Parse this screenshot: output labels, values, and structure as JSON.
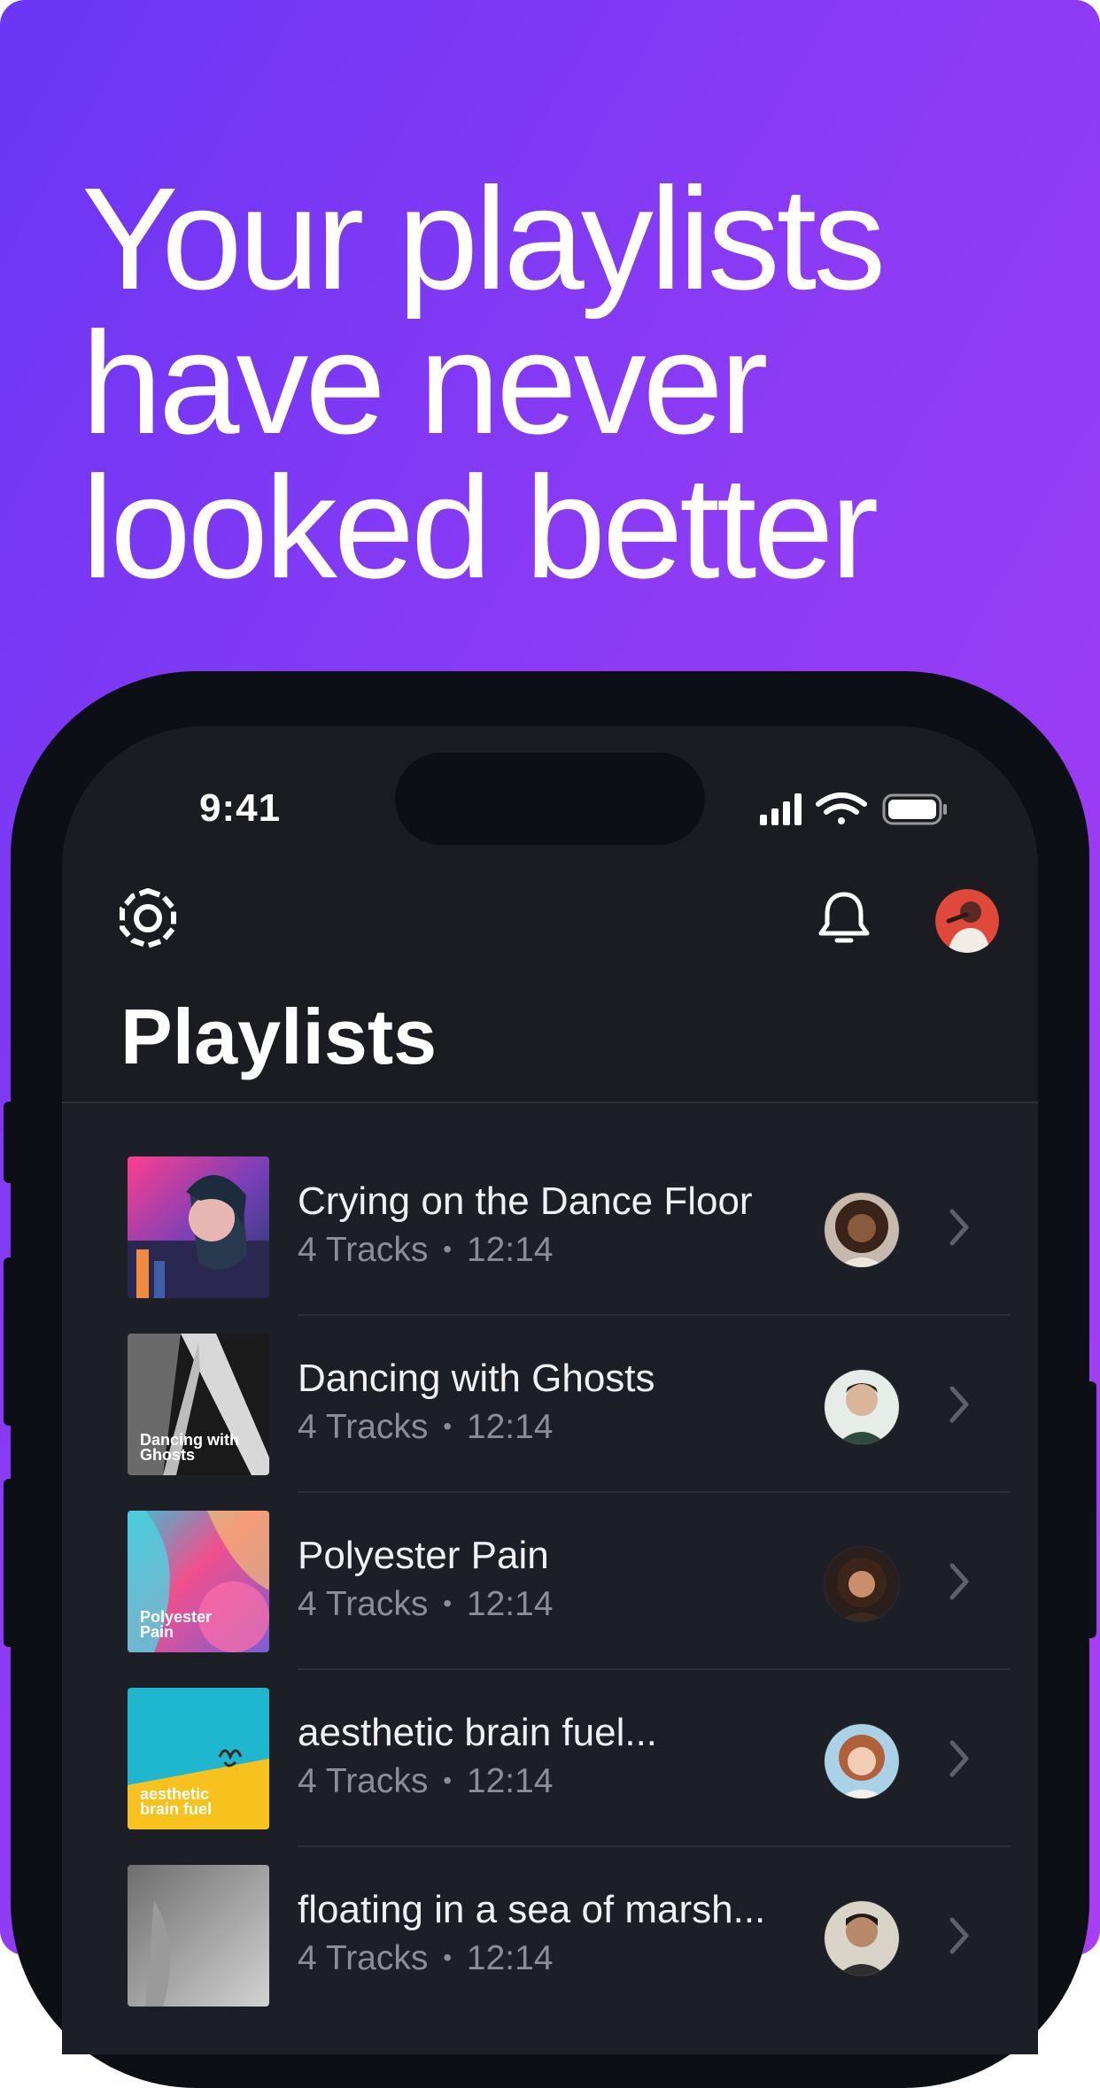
{
  "headline": [
    "Your playlists",
    "have never",
    "looked better"
  ],
  "status_bar": {
    "time": "9:41"
  },
  "header": {
    "settings_icon": "settings-gear-icon",
    "notifications_icon": "bell-icon",
    "avatar": "profile-avatar",
    "title": "Playlists"
  },
  "playlists": [
    {
      "title": "Crying on the Dance Floor",
      "tracks": "4 Tracks",
      "duration": "12:14",
      "cover_caption": ""
    },
    {
      "title": "Dancing with Ghosts",
      "tracks": "4 Tracks",
      "duration": "12:14",
      "cover_caption": "Dancing with Ghosts"
    },
    {
      "title": "Polyester Pain",
      "tracks": "4 Tracks",
      "duration": "12:14",
      "cover_caption": "Polyester Pain"
    },
    {
      "title": "aesthetic brain fuel...",
      "tracks": "4 Tracks",
      "duration": "12:14",
      "cover_caption": "aesthetic brain fuel"
    },
    {
      "title": "floating in a sea of marsh...",
      "tracks": "4 Tracks",
      "duration": "12:14",
      "cover_caption": ""
    }
  ],
  "separator": "•",
  "colors": {
    "gradient_start": "#6a36f5",
    "gradient_end": "#a93ef4",
    "phone_frame": "#0c0f14",
    "screen_bg": "#1b1c21",
    "list_bg": "#1d1f26",
    "subtitle": "#8c8e96"
  }
}
